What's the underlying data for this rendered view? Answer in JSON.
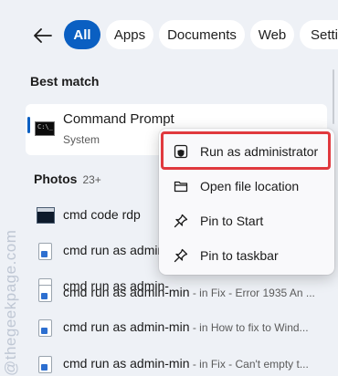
{
  "tabs": [
    {
      "label": "All",
      "active": true
    },
    {
      "label": "Apps",
      "active": false
    },
    {
      "label": "Documents",
      "active": false
    },
    {
      "label": "Web",
      "active": false
    },
    {
      "label": "Setti",
      "active": false
    }
  ],
  "best_match": {
    "heading": "Best match",
    "title": "Command Prompt",
    "subtitle": "System",
    "icon": "command-prompt-icon"
  },
  "photos": {
    "heading": "Photos",
    "count": "23+"
  },
  "results": [
    {
      "title": "cmd code rdp",
      "detail": "",
      "icon": "image-thumbnail"
    },
    {
      "title": "cmd run as admin-",
      "detail": "",
      "icon": "document-image-icon"
    },
    {
      "title": "cmd run as admin-",
      "detail": "",
      "icon": "document-image-icon"
    },
    {
      "title": "cmd run as admin-min",
      "detail": " - in Fix - Error 1935 An ...",
      "icon": "document-image-icon"
    },
    {
      "title": "cmd run as admin-min",
      "detail": " - in How to fix to Wind...",
      "icon": "document-image-icon"
    },
    {
      "title": "cmd run as admin-min",
      "detail": " - in Fix - Can't empty t...",
      "icon": "document-image-icon"
    }
  ],
  "context_menu": {
    "items": [
      {
        "label": "Run as administrator",
        "icon": "shield-icon",
        "highlighted": true
      },
      {
        "label": "Open file location",
        "icon": "folder-icon",
        "highlighted": false
      },
      {
        "label": "Pin to Start",
        "icon": "pin-icon",
        "highlighted": false
      },
      {
        "label": "Pin to taskbar",
        "icon": "pin-icon",
        "highlighted": false
      }
    ]
  },
  "watermark": "@thegeekpage.com",
  "colors": {
    "accent": "#0a5fc2",
    "background": "#eef1f6",
    "highlight_border": "#e0393e"
  }
}
